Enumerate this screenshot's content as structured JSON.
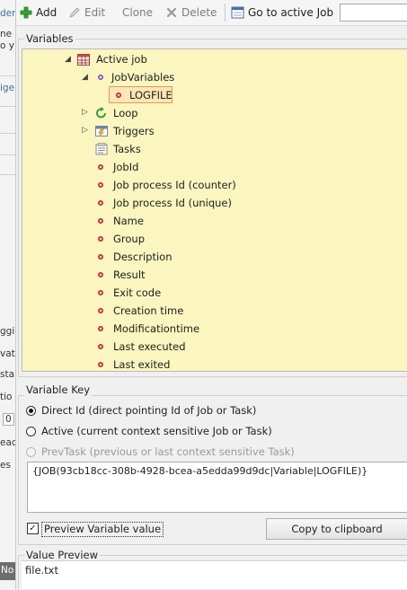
{
  "toolbar": {
    "add_label": "Add",
    "edit_label": "Edit",
    "clone_label": "Clone",
    "delete_label": "Delete",
    "go_to_active_job_label": "Go to active Job",
    "search_value": ""
  },
  "left_strip": {
    "t1": "der",
    "t2": "ne",
    "t3": "o y",
    "t4": "ige",
    "t5": "ggin",
    "t6": "vate",
    "t7": "sta",
    "t8": "tio",
    "t9": "0",
    "t10": "ead",
    "t11": "es",
    "t12": "No"
  },
  "variables": {
    "group_label": "Variables",
    "tree": {
      "active_job": "Active job",
      "job_variables": "JobVariables",
      "logfile": "LOGFILE",
      "loop": "Loop",
      "triggers": "Triggers",
      "tasks": "Tasks",
      "items": [
        "JobId",
        "Job process Id (counter)",
        "Job process Id (unique)",
        "Name",
        "Group",
        "Description",
        "Result",
        "Exit code",
        "Creation time",
        "Modificationtime",
        "Last executed",
        "Last exited"
      ]
    }
  },
  "variable_key": {
    "group_label": "Variable Key",
    "direct_id": "Direct Id (direct pointing Id of Job or Task)",
    "active": "Active (current context sensitive Job or Task)",
    "prev_task": "PrevTask (previous or last context sensitive Task)",
    "selected_option": "direct_id",
    "expression": "{JOB(93cb18cc-308b-4928-bcea-a5edda99d9dc|Variable|LOGFILE)}",
    "preview_label": "Preview Variable value",
    "preview_checked": true,
    "copy_button": "Copy to clipboard"
  },
  "value_preview": {
    "group_label": "Value Preview",
    "value": "file.txt"
  },
  "colors": {
    "tree_background": "#fbf6bf",
    "selection_fill": "#fde6b6",
    "selection_border": "#e59a4b",
    "variable_dot": "#e0484e"
  },
  "icons": {
    "add": "plus-icon",
    "edit": "pencil-icon",
    "delete": "x-icon",
    "go_to_job": "window-icon",
    "active_job": "calendar-table-icon",
    "loop": "loop-arrow-icon",
    "triggers": "trigger-icon",
    "tasks": "tasks-icon"
  }
}
